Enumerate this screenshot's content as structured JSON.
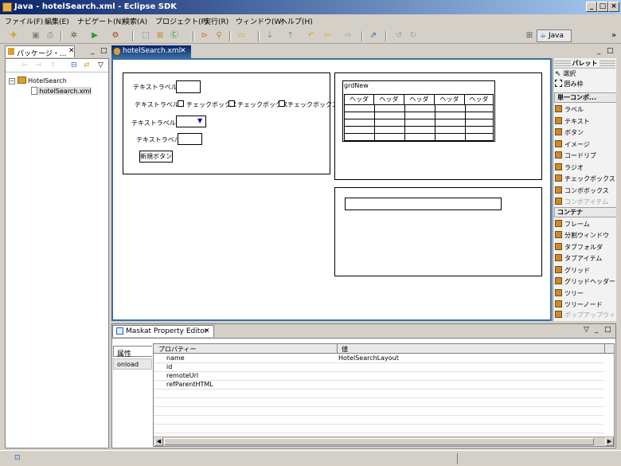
{
  "window": {
    "title": "Java - hotelSearch.xml - Eclipse SDK"
  },
  "menu": [
    "ファイル(F)",
    "編集(E)",
    "ナビゲート(N)",
    "検索(A)",
    "プロジェクト(P)",
    "実行(R)",
    "ウィンドウ(W)",
    "ヘルプ(H)"
  ],
  "perspective": {
    "label": "Java"
  },
  "package_view": {
    "tab_label": "パッケージ・...",
    "tree": [
      {
        "label": "HotelSearch",
        "level": 0
      },
      {
        "label": "hotelSearch.xml",
        "level": 1
      }
    ]
  },
  "editor": {
    "tab_label": "hotelSearch.xml",
    "form": {
      "text_label": "テキストラベル",
      "checkbox_label": "チェックボックス",
      "new_button": "新規ボタン"
    },
    "grid": {
      "name": "grdNew",
      "header": "ヘッダ"
    }
  },
  "palette": {
    "title": "パレット",
    "select": "選択",
    "marquee": "囲み枠",
    "single_header": "単一コンポ...",
    "single_items": [
      "ラベル",
      "テキスト",
      "ボタン",
      "イメージ",
      "コードリブ",
      "ラジオ",
      "チェックボックス",
      "コンボボックス",
      "コンボアイテム"
    ],
    "container_header": "コンテナ",
    "container_items": [
      "フレーム",
      "分割ウィンドウ",
      "タブフォルダ",
      "タブアイテム",
      "グリッド",
      "グリッドヘッダー",
      "ツリー",
      "ツリーノード",
      "ポップアップウィ"
    ]
  },
  "property_editor": {
    "tab_label": "Maskat Property Editor",
    "side_tabs": [
      "属性",
      "onload"
    ],
    "col_property": "プロパティー",
    "col_value": "値",
    "rows": [
      {
        "key": "name",
        "value": "HotelSearchLayout"
      },
      {
        "key": "id",
        "value": ""
      },
      {
        "key": "remoteUrl",
        "value": ""
      },
      {
        "key": "refParentHTML",
        "value": ""
      }
    ]
  }
}
